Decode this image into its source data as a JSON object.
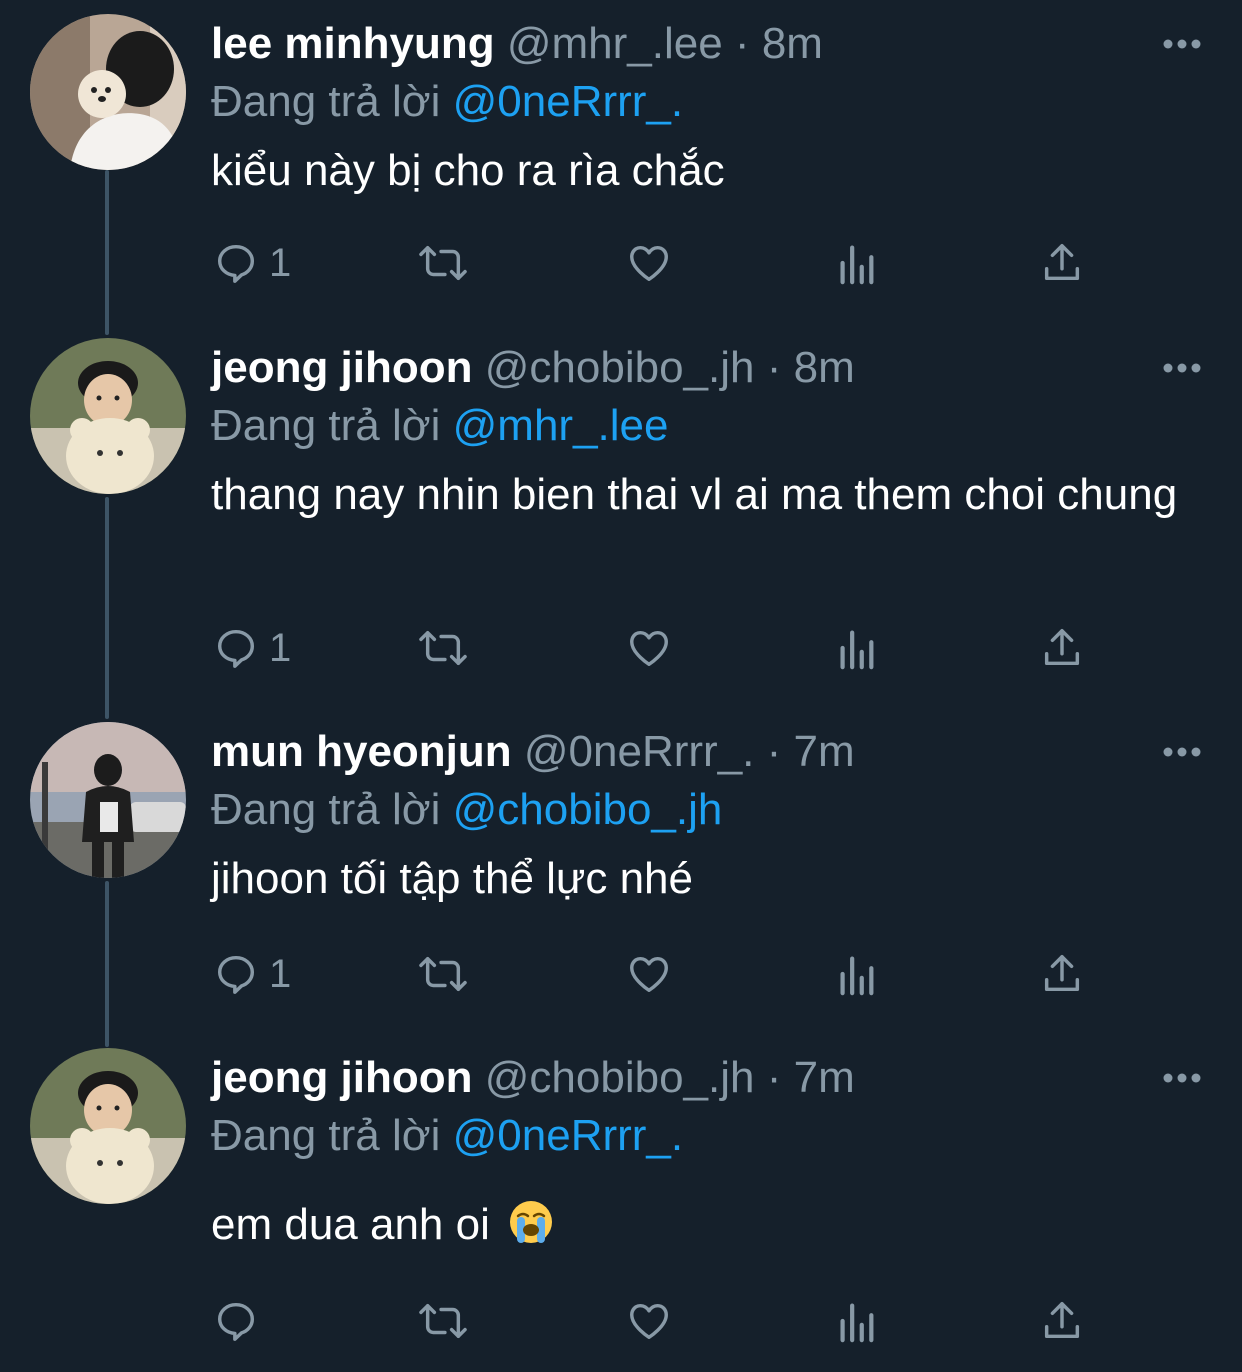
{
  "colors": {
    "background": "#15202b",
    "name_text": "#ffffff",
    "secondary_text": "#8899a6",
    "link": "#1da1f2",
    "thread_line": "#3d5466"
  },
  "tweets": [
    {
      "name": "lee minhyung",
      "handle": "@mhr_.lee",
      "separator": "·",
      "time": "8m",
      "reply_prefix": "Đang trả lời",
      "reply_to": "@0neRrrr_.",
      "text": "kiểu này bị cho ra rìa chắc",
      "reply_count": "1",
      "avatar_icon": "avatar-photo"
    },
    {
      "name": "jeong jihoon",
      "handle": "@chobibo_.jh",
      "separator": "·",
      "time": "8m",
      "reply_prefix": "Đang trả lời",
      "reply_to": "@mhr_.lee",
      "text": "thang nay nhin bien thai vl ai ma them choi chung",
      "reply_count": "1",
      "avatar_icon": "avatar-photo"
    },
    {
      "name": "mun hyeonjun",
      "handle": "@0neRrrr_.",
      "separator": "·",
      "time": "7m",
      "reply_prefix": "Đang trả lời",
      "reply_to": "@chobibo_.jh",
      "text": "jihoon tối tập thể lực nhé",
      "reply_count": "1",
      "avatar_icon": "avatar-photo"
    },
    {
      "name": "jeong jihoon",
      "handle": "@chobibo_.jh",
      "separator": "·",
      "time": "7m",
      "reply_prefix": "Đang trả lời",
      "reply_to": "@0neRrrr_.",
      "text": "em dua anh oi",
      "emoji": "loudly-crying-face-emoji",
      "reply_count": "",
      "avatar_icon": "avatar-photo"
    }
  ],
  "action_icons": [
    "reply-icon",
    "retweet-icon",
    "like-icon",
    "analytics-icon",
    "share-icon"
  ],
  "more_icon": "more-options-icon"
}
